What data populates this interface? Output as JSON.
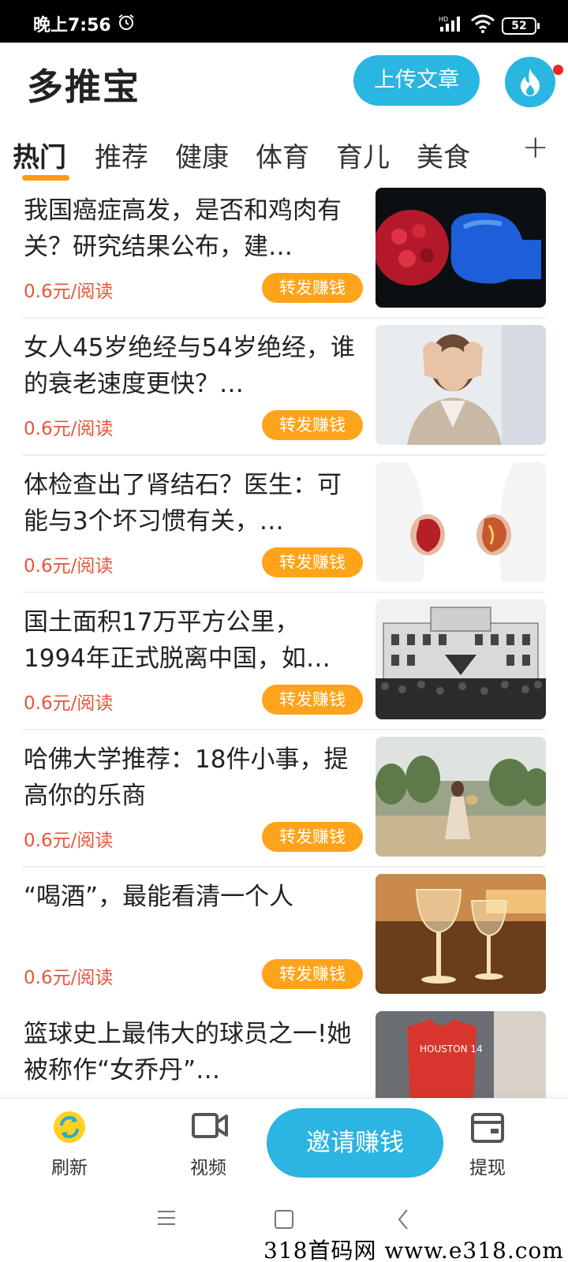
{
  "status": {
    "time": "晚上7:56",
    "network": "HD",
    "battery": "52"
  },
  "header": {
    "title": "多推宝",
    "upload_label": "上传文章"
  },
  "tabs": {
    "items": [
      {
        "label": "热门"
      },
      {
        "label": "推荐"
      },
      {
        "label": "健康"
      },
      {
        "label": "体育"
      },
      {
        "label": "育儿"
      },
      {
        "label": "美食"
      }
    ],
    "add_label": "+"
  },
  "articles": [
    {
      "title": "我国癌症高发，是否和鸡肉有关？研究结果公布，建…",
      "price": "0.6元/阅读",
      "action": "转发赚钱"
    },
    {
      "title": "女人45岁绝经与54岁绝经，谁的衰老速度更快？…",
      "price": "0.6元/阅读",
      "action": "转发赚钱"
    },
    {
      "title": "体检查出了肾结石？医生：可能与3个坏习惯有关，…",
      "price": "0.6元/阅读",
      "action": "转发赚钱"
    },
    {
      "title": "国土面积17万平方公里，1994年正式脱离中国，如…",
      "price": "0.6元/阅读",
      "action": "转发赚钱"
    },
    {
      "title": "哈佛大学推荐：18件小事，提高你的乐商",
      "price": "0.6元/阅读",
      "action": "转发赚钱"
    },
    {
      "title": "“喝酒”，最能看清一个人",
      "price": "0.6元/阅读",
      "action": "转发赚钱"
    },
    {
      "title": "篮球史上最伟大的球员之一!她被称作“女乔丹”…",
      "price": "",
      "action": "",
      "jersey_text": "HOUSTON 14"
    }
  ],
  "bottom_nav": {
    "refresh": "刷新",
    "video": "视频",
    "invite": "邀请赚钱",
    "withdraw": "提现"
  },
  "watermark": "318首码网 www.e318.com",
  "colors": {
    "accent_blue": "#29b6e0",
    "accent_orange": "#ffa31a",
    "price_red": "#e8553a"
  }
}
